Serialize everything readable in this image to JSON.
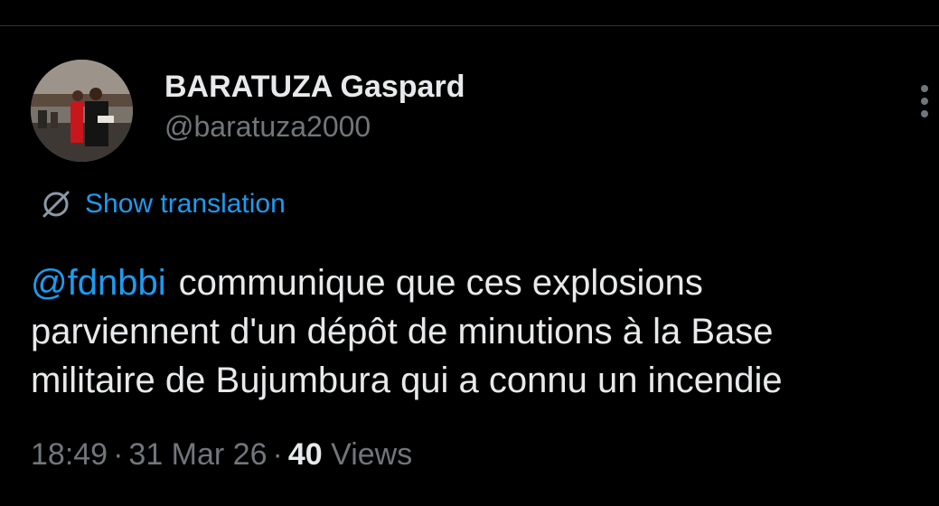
{
  "author": {
    "display_name": "BARATUZA Gaspard",
    "handle": "@baratuza2000",
    "avatar_icon": "avatar-photo"
  },
  "menu": {
    "more_icon": "more-vertical-icon"
  },
  "translation": {
    "icon": "globe-icon",
    "label": "Show translation"
  },
  "tweet": {
    "mention": "@fdnbbi",
    "line1": "communique que ces explosions",
    "line2": "parviennent d'un dépôt de minutions à la Base",
    "line3": "militaire de Bujumbura qui a connu un incendie"
  },
  "meta": {
    "time": "18:49",
    "separator": "·",
    "date": "31 Mar 26",
    "views_count": "40",
    "views_label": "Views"
  },
  "colors": {
    "background": "#000000",
    "text": "#e7e9ea",
    "muted": "#71767b",
    "link": "#1d9bf0"
  }
}
